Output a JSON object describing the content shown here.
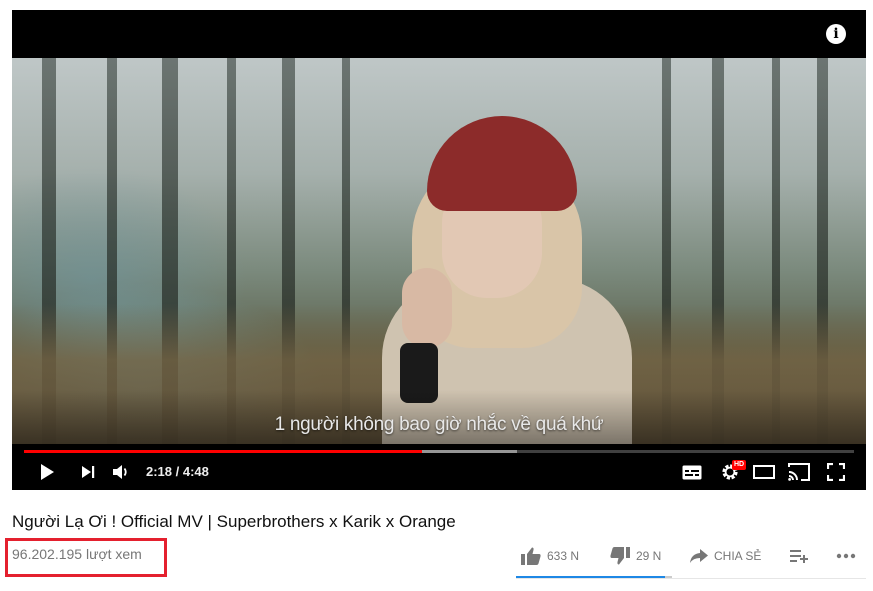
{
  "player": {
    "subtitle": "1 người không bao giờ nhắc về quá khứ",
    "info_glyph": "i",
    "current_time": "2:18",
    "duration": "4:48",
    "time_display": "2:18 / 4:48",
    "played_fraction": 0.479,
    "buffered_fraction": 0.594,
    "hd_badge": "HD",
    "accent_color": "#ff0000"
  },
  "video": {
    "title": "Người Lạ Ơi ! Official MV | Superbrothers x Karik x Orange",
    "views": "96.202.195 lượt xem"
  },
  "actions": {
    "like_count": "633 N",
    "dislike_count": "29 N",
    "share_label": "CHIA SẺ",
    "like_fraction": 0.956,
    "like_color": "#1e88e5",
    "highlight_color": "#e4202e"
  }
}
